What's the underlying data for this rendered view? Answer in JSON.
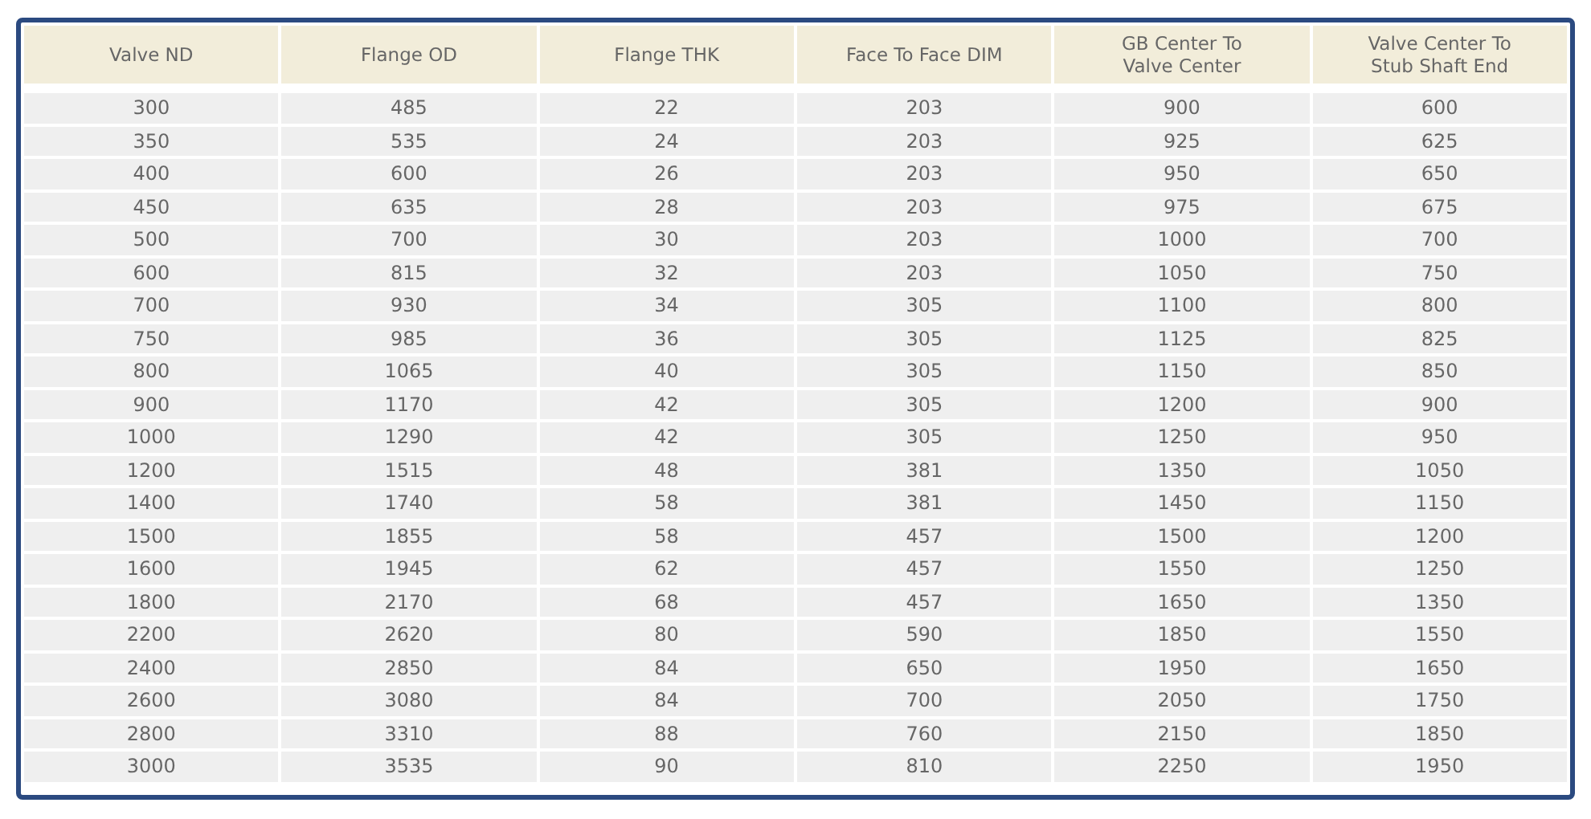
{
  "table": {
    "columns": [
      "Valve ND",
      "Flange OD",
      "Flange THK",
      "Face To Face DIM",
      "GB Center To\nValve Center",
      "Valve Center To\nStub Shaft End"
    ],
    "rows": [
      [
        "300",
        "485",
        "22",
        "203",
        "900",
        "600"
      ],
      [
        "350",
        "535",
        "24",
        "203",
        "925",
        "625"
      ],
      [
        "400",
        "600",
        "26",
        "203",
        "950",
        "650"
      ],
      [
        "450",
        "635",
        "28",
        "203",
        "975",
        "675"
      ],
      [
        "500",
        "700",
        "30",
        "203",
        "1000",
        "700"
      ],
      [
        "600",
        "815",
        "32",
        "203",
        "1050",
        "750"
      ],
      [
        "700",
        "930",
        "34",
        "305",
        "1100",
        "800"
      ],
      [
        "750",
        "985",
        "36",
        "305",
        "1125",
        "825"
      ],
      [
        "800",
        "1065",
        "40",
        "305",
        "1150",
        "850"
      ],
      [
        "900",
        "1170",
        "42",
        "305",
        "1200",
        "900"
      ],
      [
        "1000",
        "1290",
        "42",
        "305",
        "1250",
        "950"
      ],
      [
        "1200",
        "1515",
        "48",
        "381",
        "1350",
        "1050"
      ],
      [
        "1400",
        "1740",
        "58",
        "381",
        "1450",
        "1150"
      ],
      [
        "1500",
        "1855",
        "58",
        "457",
        "1500",
        "1200"
      ],
      [
        "1600",
        "1945",
        "62",
        "457",
        "1550",
        "1250"
      ],
      [
        "1800",
        "2170",
        "68",
        "457",
        "1650",
        "1350"
      ],
      [
        "2200",
        "2620",
        "80",
        "590",
        "1850",
        "1550"
      ],
      [
        "2400",
        "2850",
        "84",
        "650",
        "1950",
        "1650"
      ],
      [
        "2600",
        "3080",
        "84",
        "700",
        "2050",
        "1750"
      ],
      [
        "2800",
        "3310",
        "88",
        "760",
        "2150",
        "1850"
      ],
      [
        "3000",
        "3535",
        "90",
        "810",
        "2250",
        "1950"
      ]
    ]
  }
}
